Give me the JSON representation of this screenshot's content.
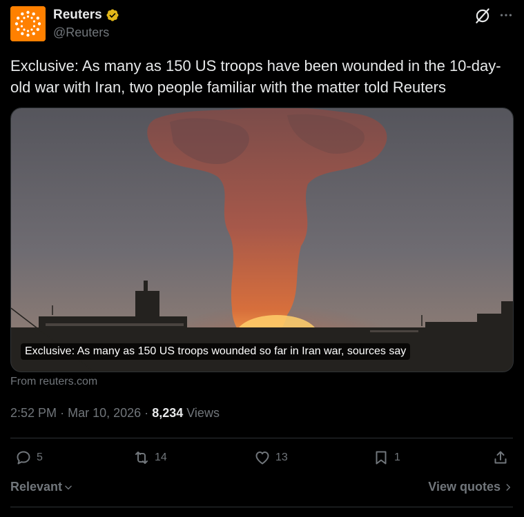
{
  "author": {
    "name": "Reuters",
    "handle": "@Reuters",
    "verified_badge": "verified-gold-badge",
    "avatar_color": "#ff8000"
  },
  "tweet": {
    "text": "Exclusive: As many as 150 US troops have been wounded in the 10-day-old war with Iran, two people familiar with the matter told Reuters"
  },
  "card": {
    "title": "Exclusive: As many as 150 US troops wounded so far in Iran war, sources say",
    "source": "From reuters.com"
  },
  "meta": {
    "time": "2:52 PM",
    "date": "Mar 10, 2026",
    "separator": "·",
    "views_count": "8,234",
    "views_label": "Views"
  },
  "actions": {
    "replies": "5",
    "reposts": "14",
    "likes": "13",
    "bookmarks": "1"
  },
  "sort": {
    "label": "Relevant",
    "view_quotes": "View quotes"
  },
  "colors": {
    "background": "#000000",
    "text_primary": "#e7e9ea",
    "text_secondary": "#71767b",
    "border": "#2f3336",
    "verified_gold": "#e2b719"
  }
}
